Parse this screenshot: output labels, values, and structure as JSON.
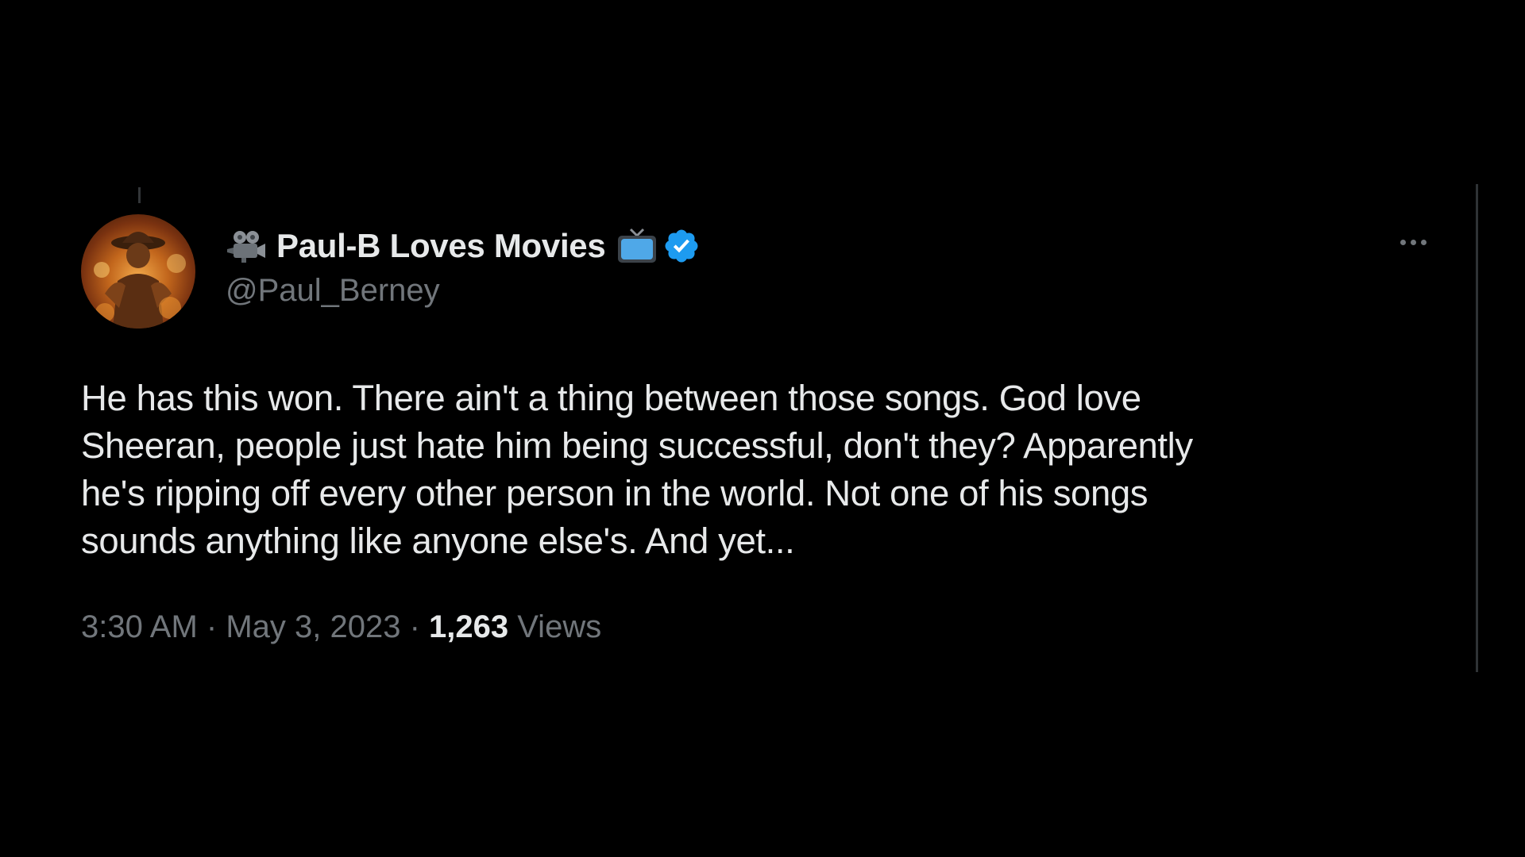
{
  "colors": {
    "background": "#000000",
    "primary_text": "#e7e9ea",
    "secondary_text": "#71767b",
    "verified_badge": "#1d9bf0",
    "divider": "#2f3336"
  },
  "tweet": {
    "author": {
      "display_name": "Paul-B Loves Movies",
      "handle": "@Paul_Berney",
      "avatar_icon": "avatar-image",
      "name_prefix_icon": "movie-camera-emoji-icon",
      "name_suffix_icon": "television-emoji-icon",
      "verified_icon": "verified-badge-icon"
    },
    "more_icon": "more-options-icon",
    "text": "He has this won. There ain't a thing between those songs. God love\nSheeran, people just hate him being successful, don't they? Apparently\nhe's ripping off every other person in the world. Not one of his songs\nsounds anything like anyone else's. And yet...",
    "meta": {
      "time": "3:30 AM",
      "separator": " · ",
      "date": "May 3, 2023",
      "views_count": "1,263",
      "views_label": " Views"
    }
  }
}
